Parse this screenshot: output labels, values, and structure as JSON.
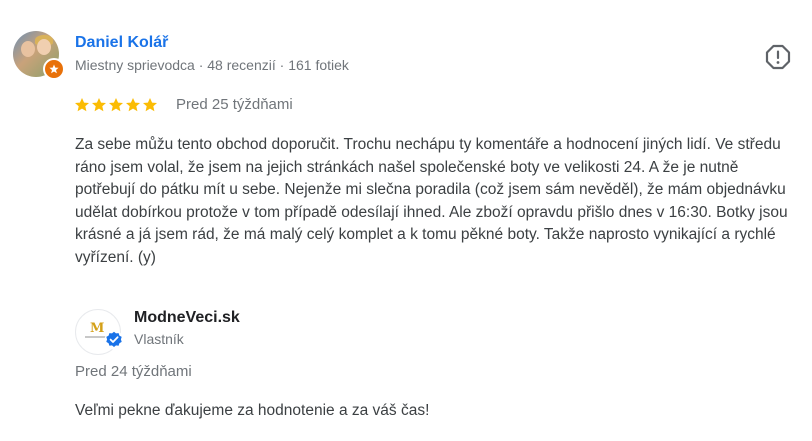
{
  "reviewer": {
    "name": "Daniel Kolář",
    "meta": "Miestny sprievodca · 48 recenzií · 161 fotiek",
    "avatar_icon": "user-avatar",
    "badge_icon": "local-guide-badge-icon"
  },
  "review": {
    "rating": 5,
    "max_rating": 5,
    "star_color": "#fbbc04",
    "date": "Pred 25 týždňami",
    "text": "Za sebe můžu tento obchod doporučit. Trochu nechápu ty komentáře a hodnocení jiných lidí. Ve středu ráno jsem volal, že jsem na jejich stránkách našel společenské boty ve velikosti 24. A že je nutně potřebují do pátku mít u sebe. Nejenže mi slečna poradila (což jsem sám nevěděl), že mám objednávku udělat dobírkou protože v tom případě odesílají ihned. Ale zboží opravdu přišlo dnes v 16:30. Botky jsou krásné a já jsem rád, že má malý celý komplet a k tomu pěkné boty. Takže naprosto vynikající a rychlé vyřízení. (y)"
  },
  "owner_reply": {
    "name": "ModneVeci.sk",
    "role": "Vlastník",
    "date": "Pred 24 týždňami",
    "text": "Veľmi pekne ďakujeme za hodnotenie a za váš čas!",
    "logo_icon": "modneveci-logo",
    "verified_icon": "verified-check-icon",
    "verified_color": "#1a73e8"
  },
  "actions": {
    "report_icon": "report-flag-icon"
  },
  "colors": {
    "name_link": "#1a73e8",
    "secondary_text": "#70757a",
    "body_text": "#3c4043",
    "guide_badge": "#e8710a"
  }
}
